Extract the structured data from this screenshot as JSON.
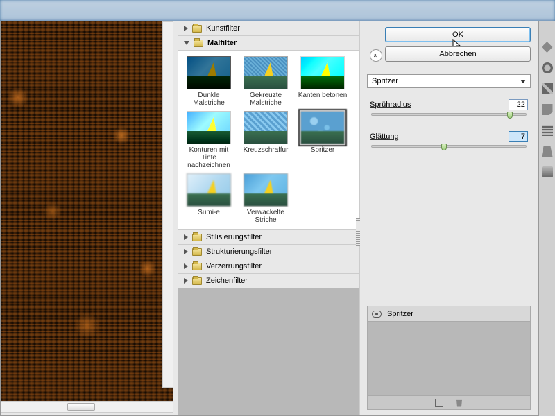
{
  "buttons": {
    "ok": "OK",
    "cancel": "Abbrechen"
  },
  "categories": {
    "kunstfilter": "Kunstfilter",
    "malfilter": "Malfilter",
    "stilisierung": "Stilisierungsfilter",
    "strukturierung": "Strukturierungsfilter",
    "verzerrung": "Verzerrungsfilter",
    "zeichen": "Zeichenfilter"
  },
  "thumbs": {
    "dunkle": "Dunkle Malstriche",
    "gekreuzte": "Gekreuzte Malstriche",
    "kanten": "Kanten betonen",
    "konturen": "Konturen mit Tinte nachzeichnen",
    "kreuz": "Kreuzschraffur",
    "spritzer": "Spritzer",
    "sumi": "Sumi-e",
    "verwackelte": "Verwackelte Striche"
  },
  "dropdown": {
    "selected": "Spritzer"
  },
  "params": {
    "radius_label": "Sprühradius",
    "radius_value": "22",
    "smooth_label": "Glättung",
    "smooth_value": "7"
  },
  "layers": {
    "item1": "Spritzer"
  }
}
